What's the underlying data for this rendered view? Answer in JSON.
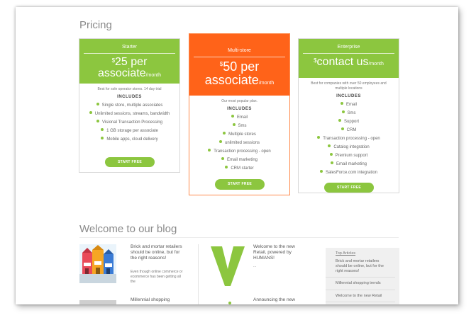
{
  "pricing": {
    "title": "Pricing",
    "plans": [
      {
        "name": "Starter",
        "currency": "$",
        "price": "25 per",
        "unit": "associate",
        "period": "/month",
        "note": "Best for sole operator stores. 14 day trial",
        "includes_label": "INCLUDES",
        "features": [
          "Single store, multiple associates",
          "Unlimited sessions, streams, bandwidth",
          "Visional Transaction Processing",
          "1 GB storage per associate",
          "Mobile apps, cloud delivery"
        ],
        "button": "START FREE",
        "color": "#8cc63f"
      },
      {
        "name": "Multi-store",
        "currency": "$",
        "price": "50 per",
        "unit": "associate",
        "period": "/month",
        "note": "Our most popular plan.",
        "includes_label": "INCLUDES",
        "features": [
          "Email",
          "Sms",
          "Multiple stores",
          "unlimited sessions",
          "Transaction processing - open",
          "Email marketing",
          "CRM starter"
        ],
        "button": "START FREE",
        "color": "#ff6319"
      },
      {
        "name": "Enterprise",
        "currency": "$",
        "price": "contact us",
        "unit": "",
        "period": "/month",
        "note": "Best for companies with over 50 employees and multiple locations",
        "includes_label": "INCLUDES",
        "features": [
          "Email",
          "Sms",
          "Support",
          "CRM",
          "Transaction processing - open",
          "Catalog integration",
          "Premium support",
          "Email marketing",
          "SalesForce.com integration"
        ],
        "button": "START FREE",
        "color": "#8cc63f"
      }
    ]
  },
  "blog": {
    "title": "Welcome to our blog",
    "posts": [
      {
        "title": "Brick and mortar retailers should be online, but for the right reasons!",
        "excerpt": "Even though online commerce or ecommerce has been getting all the"
      },
      {
        "title": "Millennial shopping",
        "excerpt": ""
      },
      {
        "title": "Welcome to the new Retail, powered by HUMANS!",
        "excerpt": "..."
      },
      {
        "title": "Announcing the new",
        "excerpt": ""
      }
    ],
    "sidebar": {
      "heading": "Top Articles",
      "items": [
        "Brick and mortar retailers should be online, but for the right reasons!",
        "Millennial shopping trends",
        "Welcome to the new Retail"
      ]
    }
  }
}
